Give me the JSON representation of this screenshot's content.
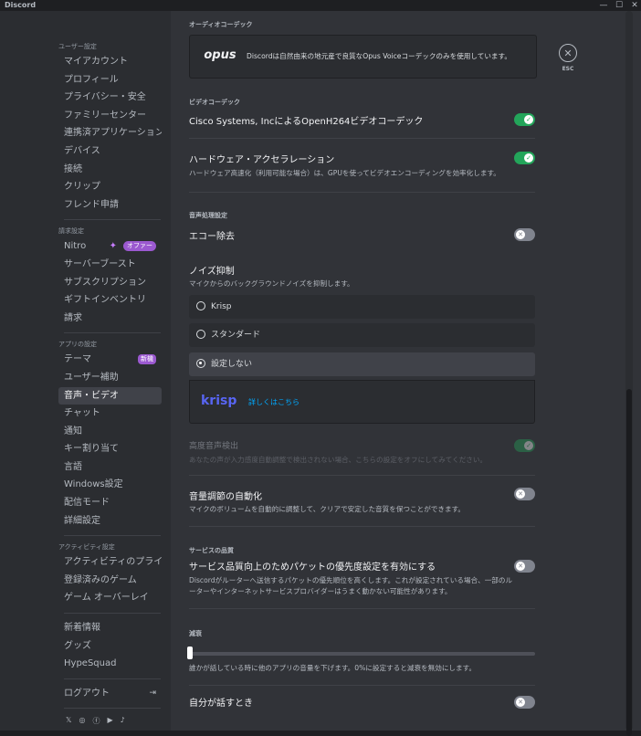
{
  "titlebar": {
    "app_name": "Discord",
    "minimize": "—",
    "maximize": "☐",
    "close": "✕"
  },
  "sidebar": {
    "sections": [
      {
        "header": "ユーザー設定",
        "items": [
          "マイアカウント",
          "プロフィール",
          "プライバシー・安全",
          "ファミリーセンター",
          "連携済アプリケーション",
          "デバイス",
          "接続",
          "クリップ",
          "フレンド申請"
        ]
      },
      {
        "header": "請求設定",
        "items": [
          "Nitro",
          "サーバーブースト",
          "サブスクリプション",
          "ギフトインベントリ",
          "請求"
        ]
      },
      {
        "header": "アプリの設定",
        "items": [
          "テーマ",
          "ユーザー補助",
          "音声・ビデオ",
          "チャット",
          "通知",
          "キー割り当て",
          "言語",
          "Windows設定",
          "配信モード",
          "詳細設定"
        ]
      },
      {
        "header": "アクティビティ設定",
        "items": [
          "アクティビティのプライバシー",
          "登録済みのゲーム",
          "ゲーム オーバーレイ"
        ]
      },
      {
        "header": "",
        "items": [
          "新着情報",
          "グッズ",
          "HypeSquad"
        ]
      }
    ],
    "nitro_badge": "オファー",
    "theme_badge": "新機",
    "active_item": "音声・ビデオ",
    "logout": "ログアウト",
    "social_icons": [
      "x-icon",
      "instagram-icon",
      "facebook-icon",
      "youtube-icon",
      "tiktok-icon"
    ]
  },
  "main": {
    "audio_codec": {
      "label": "オーディオコーデック",
      "logo": "opus",
      "text": "Discordは自然由来の地元産で良質なOpus Voiceコーデックのみを使用しています。"
    },
    "esc": {
      "label": "ESC"
    },
    "video_codec": {
      "label": "ビデオコーデック",
      "openh264": {
        "title": "Cisco Systems, IncによるOpenH264ビデオコーデック",
        "on": true
      },
      "hw_accel": {
        "title": "ハードウェア・アクセラレーション",
        "desc": "ハードウェア高速化（利用可能な場合）は、GPUを使ってビデオエンコーディングを効率化します。",
        "on": true
      }
    },
    "voice_processing": {
      "label": "音声処理設定",
      "echo": {
        "title": "エコー除去",
        "on": false
      },
      "noise": {
        "title": "ノイズ抑制",
        "desc": "マイクからのバックグラウンドノイズを抑制します。",
        "options": [
          "Krisp",
          "スタンダード",
          "設定しない"
        ],
        "selected": "設定しない"
      },
      "krisp": {
        "logo": "krisp",
        "link": "詳しくはこちら"
      },
      "advanced_vad": {
        "title": "高度音声検出",
        "desc": "あなたの声が入力感度自動調整で検出されない場合、こちらの設定をオフにしてみてください。",
        "on": true
      },
      "agc": {
        "title": "音量調節の自動化",
        "desc": "マイクのボリュームを自動的に調整して、クリアで安定した音質を保つことができます。",
        "on": false
      }
    },
    "qos": {
      "label": "サービスの品質",
      "title": "サービス品質向上のためパケットの優先度設定を有効にする",
      "desc1": "Discordがルーターへ送信するパケットの優先順位を高くします。これが設定されている場合、一部のル",
      "desc2": "ーターやインターネットサービスプロバイダーはうまく動かない可能性があります。",
      "on": false
    },
    "attenuation": {
      "label": "減衰",
      "value": 0,
      "desc": "誰かが話している時に他のアプリの音量を下げます。0%に設定すると減衰を無効にします。"
    },
    "when_speak": {
      "title": "自分が話すとき",
      "on": false
    }
  },
  "colors": {
    "accent_green": "#23a55a",
    "toggle_off": "#80848e",
    "nitro_purple": "#9b59d0",
    "link_blue": "#00a8fc"
  }
}
